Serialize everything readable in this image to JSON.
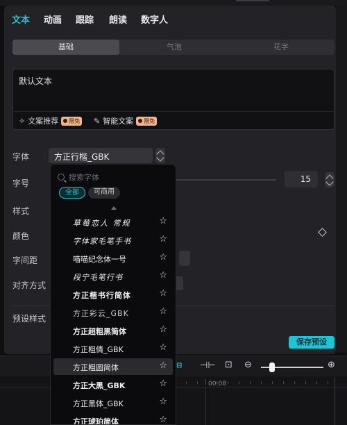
{
  "tabs": [
    "文本",
    "动画",
    "跟踪",
    "朗读",
    "数字人"
  ],
  "subtabs": [
    "基础",
    "气泡",
    "花字"
  ],
  "textbox": {
    "content": "默认文本",
    "tool1": "文案推荐",
    "tool2": "智能文案",
    "badge": "限免"
  },
  "labels": {
    "font": "字体",
    "size": "字号",
    "style": "样式",
    "color": "颜色",
    "spacing": "字间距",
    "align": "对齐方式",
    "preset": "预设样式"
  },
  "font_value": "方正行楷_GBK",
  "size_value": "15",
  "save_preset": "保存预设",
  "dropdown": {
    "search_placeholder": "搜索字体",
    "chip_all": "全部",
    "chip_commercial": "可商用",
    "items": [
      "草莓恋人 常规",
      "字体家毛笔手书",
      "喵喵纪念体一号",
      "段宁毛笔行书",
      "方正楷书行简体",
      "方正彩云_GBK",
      "方正超粗黑简体",
      "方正粗倩_GBK",
      "方正粗圆简体",
      "方正大黑_GBK",
      "方正黑体_GBK",
      "方正琥珀简体"
    ]
  },
  "timeline": {
    "time_label": "00:08"
  }
}
